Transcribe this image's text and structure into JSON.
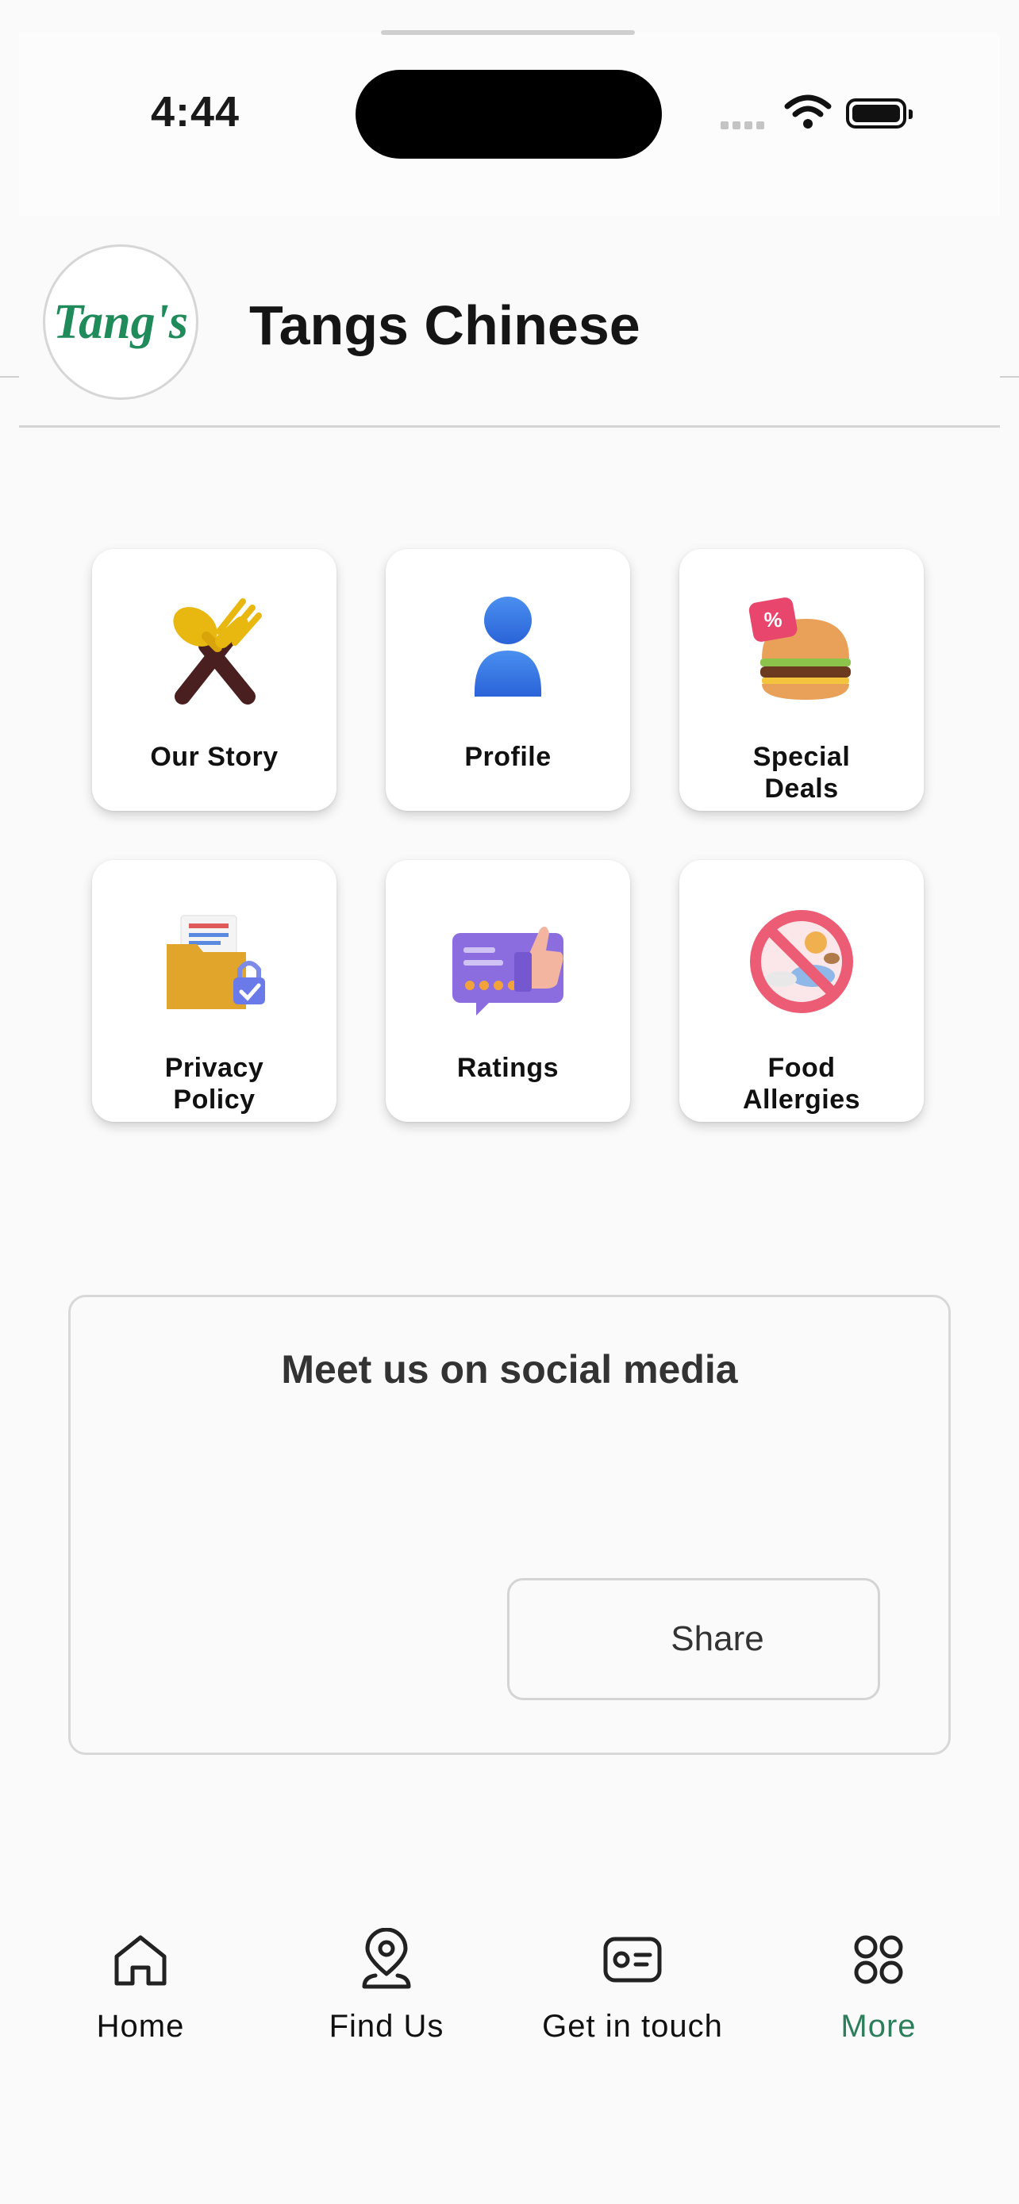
{
  "status_bar": {
    "time": "4:44"
  },
  "header": {
    "logo_text": "Tang's",
    "store_name": "Tangs Chinese"
  },
  "menu_tiles": [
    {
      "label": "Our Story",
      "icon": "fork-spoon-icon"
    },
    {
      "label": "Profile",
      "icon": "user-icon"
    },
    {
      "label": "Special\nDeals",
      "icon": "burger-discount-icon"
    },
    {
      "label": "Privacy\nPolicy",
      "icon": "folder-lock-icon"
    },
    {
      "label": "Ratings",
      "icon": "thumbs-up-rating-icon"
    },
    {
      "label": "Food\nAllergies",
      "icon": "no-allergen-icon"
    }
  ],
  "social": {
    "title": "Meet us on social media",
    "share_label": "Share"
  },
  "tab_bar": {
    "items": [
      {
        "label": "Home",
        "icon": "home-icon"
      },
      {
        "label": "Find Us",
        "icon": "location-pin-icon"
      },
      {
        "label": "Get in touch",
        "icon": "contact-card-icon"
      },
      {
        "label": "More",
        "icon": "grid-more-icon",
        "active": true
      }
    ]
  },
  "colors": {
    "accent": "#2e7d5b",
    "logo": "#1f8a5a"
  }
}
